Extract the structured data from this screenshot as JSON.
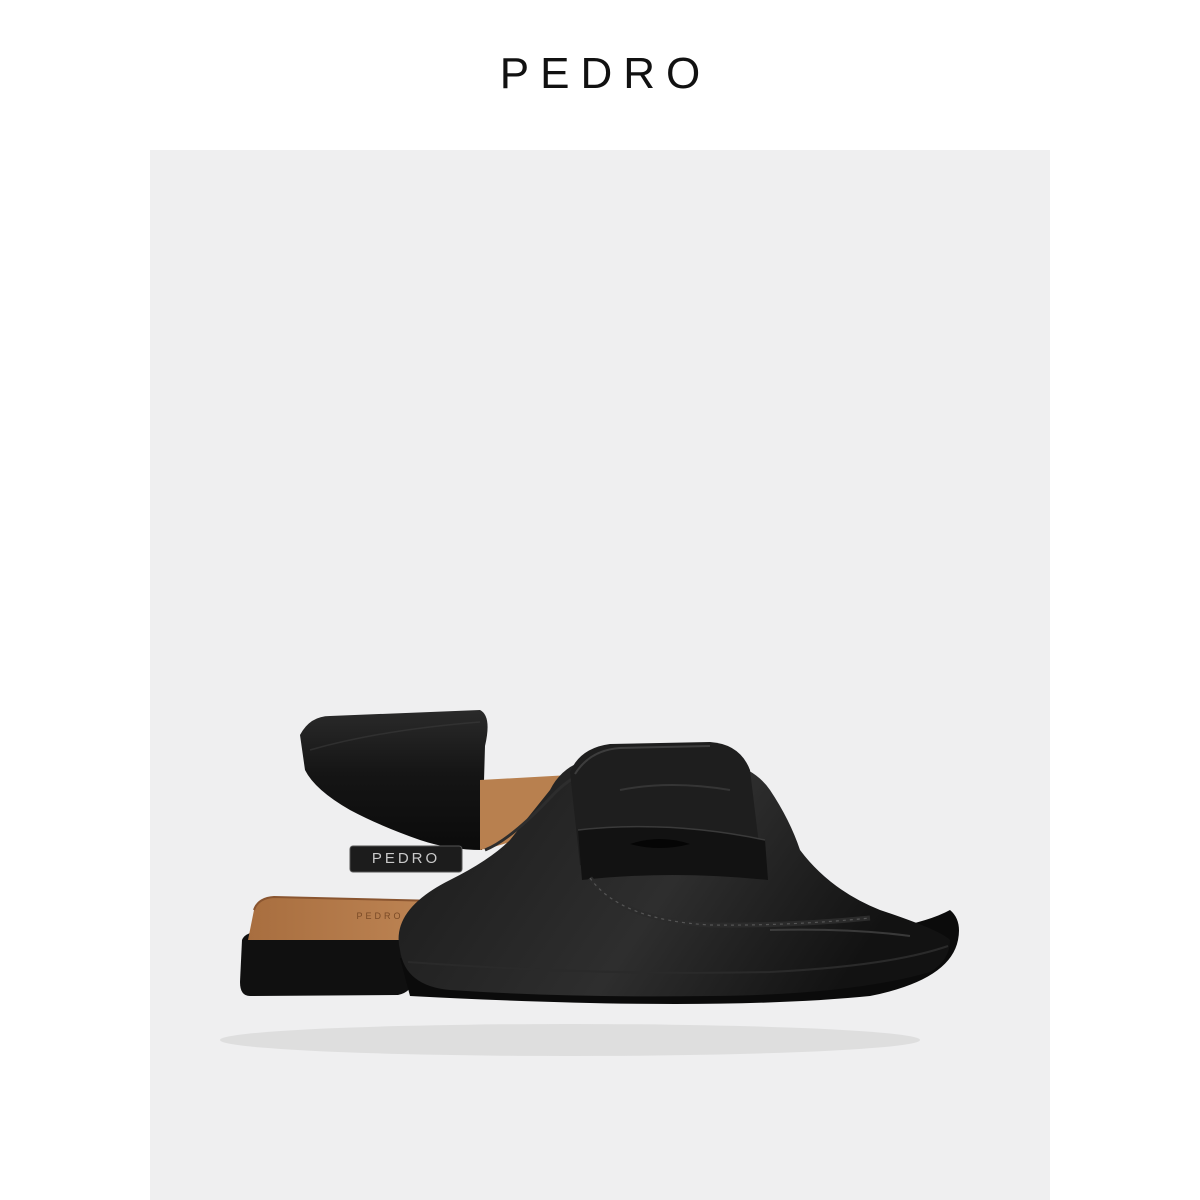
{
  "header": {
    "brand": "PEDRO"
  },
  "product_image": {
    "subject": "black-leather-slingback-penny-loafer",
    "strap_logo": "PEDRO",
    "insole_logo": "PEDRO",
    "colors": {
      "background": "#efeff0",
      "leather": "#141414",
      "leather_highlight": "#3a3a3a",
      "insole": "#b8804f",
      "sole": "#0d0d0d"
    }
  }
}
